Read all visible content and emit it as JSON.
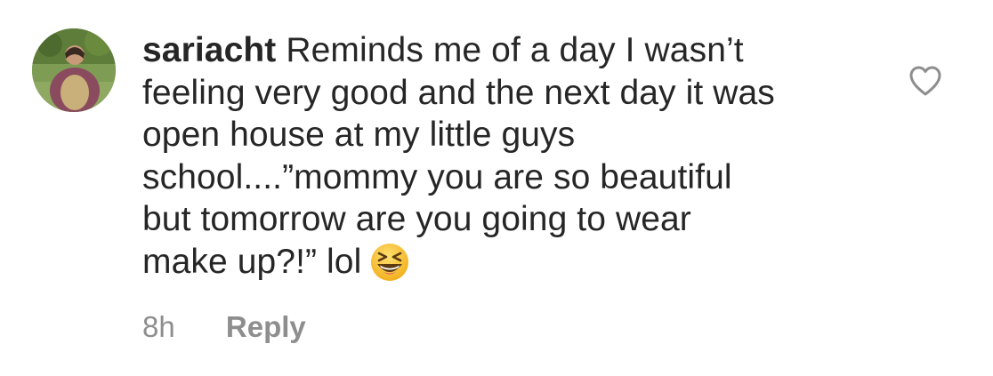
{
  "comment": {
    "username": "sariacht",
    "text_lines": [
      "Reminds me of a day I wasn’t",
      "feeling very good and the next day it was",
      "open house at my little guys",
      "school....”mommy you are so beautiful",
      "but tomorrow are you going to wear",
      "make up?!” lol"
    ],
    "emoji": "grinning-squinting-face",
    "timestamp": "8h",
    "reply_label": "Reply",
    "like_icon": "heart-outline-icon"
  },
  "colors": {
    "text": "#262626",
    "secondary_text": "#8e8e8e",
    "icon_stroke": "#8e8e8e",
    "emoji_face": "#f7c531"
  }
}
